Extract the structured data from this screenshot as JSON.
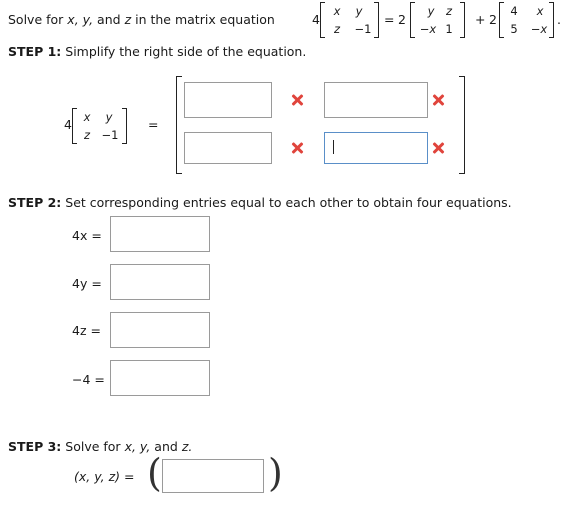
{
  "problem": {
    "prefix": "Solve for",
    "var_x": "x,",
    "var_y": "y,",
    "and": "and",
    "var_z": "z",
    "suffix": "in the matrix equation",
    "coef_left": "4",
    "lhs_matrix": [
      "x",
      "y",
      "z",
      "−1"
    ],
    "equals": "=",
    "coef_mid": "2",
    "mid_matrix": [
      "y",
      "z",
      "−x",
      "1"
    ],
    "plus": "+",
    "coef_right": "2",
    "right_matrix": [
      "4",
      "x",
      "5",
      "−x"
    ],
    "period": "."
  },
  "step1": {
    "label": "STEP 1:",
    "text": "Simplify the right side of the equation.",
    "coef": "4",
    "matrix": [
      "x",
      "y",
      "z",
      "−1"
    ],
    "equals": "="
  },
  "step2": {
    "label": "STEP 2:",
    "text": "Set corresponding entries equal to each other to obtain four equations.",
    "rows": [
      {
        "label": "4x ="
      },
      {
        "label": "4y ="
      },
      {
        "label": "4z ="
      },
      {
        "label": "−4 ="
      }
    ]
  },
  "step3": {
    "label": "STEP 3:",
    "text_prefix": "Solve for",
    "text_vars": "x, y,",
    "text_and": "and",
    "text_z": "z.",
    "tuple_label": "(x, y, z) ="
  }
}
